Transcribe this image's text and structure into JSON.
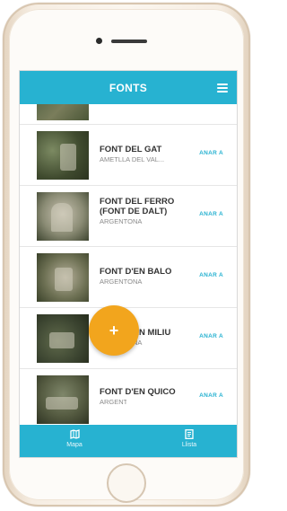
{
  "header": {
    "title": "FONTS",
    "menu_icon": "hamburger-menu-icon"
  },
  "fonts": [
    {
      "name": "FONT DEL GAT",
      "place": "AMETLLA DEL VAL...",
      "action": "ANAR A"
    },
    {
      "name": "FONT DEL FERRO (FONT DE DALT)",
      "place": "ARGENTONA",
      "action": "ANAR A"
    },
    {
      "name": "FONT D'EN BALO",
      "place": "ARGENTONA",
      "action": "ANAR A"
    },
    {
      "name": "FONT D'EN MILIU",
      "place": "ARGENTONA",
      "action": "ANAR A"
    },
    {
      "name": "FONT D'EN QUICO",
      "place": "ARGENTONA",
      "action": "ANAR A"
    }
  ],
  "fab": {
    "label": "+",
    "icon": "add-icon"
  },
  "bottom_nav": [
    {
      "label": "Mapa",
      "icon": "map-icon"
    },
    {
      "label": "Llista",
      "icon": "list-icon"
    }
  ],
  "colors": {
    "accent": "#27b2d1",
    "fab": "#f2a51d"
  }
}
